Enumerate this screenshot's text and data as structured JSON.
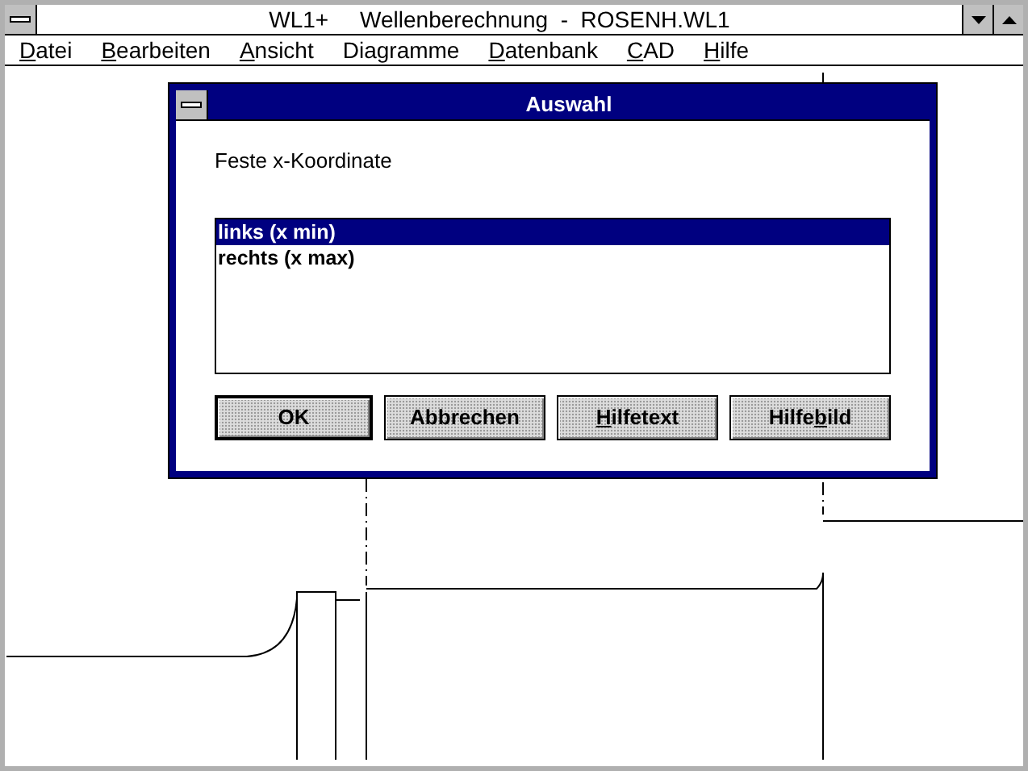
{
  "window": {
    "title": "WL1+     Wellenberechnung  -  ROSENH.WL1"
  },
  "menu": [
    {
      "key": "D",
      "after": "atei"
    },
    {
      "key": "B",
      "after": "earbeiten"
    },
    {
      "key": "A",
      "after": "nsicht"
    },
    {
      "after": "Diagramme"
    },
    {
      "key": "D",
      "after": "atenbank"
    },
    {
      "key": "C",
      "after": "AD"
    },
    {
      "key": "H",
      "after": "ilfe"
    }
  ],
  "dialog": {
    "title": "Auswahl",
    "prompt": "Feste x-Koordinate",
    "list": [
      {
        "label": "links (x min)",
        "selected": true
      },
      {
        "label": "rechts (x max)",
        "selected": false
      }
    ],
    "buttons": [
      {
        "after": "OK",
        "default": true
      },
      {
        "after": "Abbrechen",
        "default": false
      },
      {
        "key": "H",
        "after": "ilfetext",
        "default": false
      },
      {
        "before": "Hilfe",
        "key": "b",
        "after": "ild",
        "default": false
      }
    ]
  }
}
